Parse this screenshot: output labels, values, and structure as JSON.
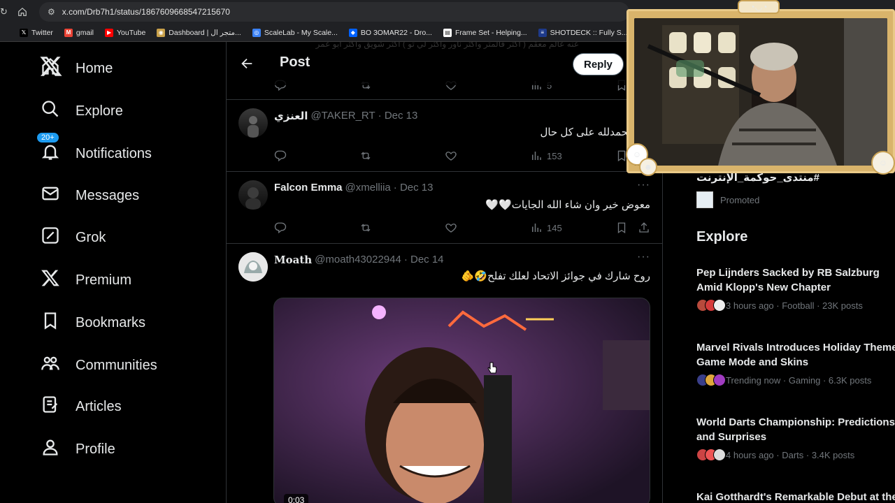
{
  "browser": {
    "url": "x.com/Drb7h1/status/1867609668547215670",
    "bookmarks": [
      {
        "label": "Twitter",
        "color": "#000000",
        "glyph": "𝕏"
      },
      {
        "label": "gmail",
        "color": "#ea4335",
        "glyph": "M"
      },
      {
        "label": "YouTube",
        "color": "#ff0000",
        "glyph": "▶"
      },
      {
        "label": "Dashboard | متجر ال...",
        "color": "#c9a14a",
        "glyph": "◉"
      },
      {
        "label": "ScaleLab - My Scale...",
        "color": "#3b82f6",
        "glyph": "◎"
      },
      {
        "label": "BO 3OMAR22 - Dro...",
        "color": "#0061fe",
        "glyph": "◆"
      },
      {
        "label": "Frame Set - Helping...",
        "color": "#ffffff",
        "glyph": "▤"
      },
      {
        "label": "SHOTDECK :: Fully S...",
        "color": "#1e3a8a",
        "glyph": "≡"
      }
    ]
  },
  "nav": {
    "items": [
      {
        "label": "Home",
        "icon": "home-icon"
      },
      {
        "label": "Explore",
        "icon": "search-icon"
      },
      {
        "label": "Notifications",
        "icon": "bell-icon",
        "badge": "20+"
      },
      {
        "label": "Messages",
        "icon": "envelope-icon"
      },
      {
        "label": "Grok",
        "icon": "grok-icon"
      },
      {
        "label": "Premium",
        "icon": "x-logo-icon"
      },
      {
        "label": "Bookmarks",
        "icon": "bookmark-icon"
      },
      {
        "label": "Communities",
        "icon": "communities-icon"
      },
      {
        "label": "Articles",
        "icon": "articles-icon"
      },
      {
        "label": "Profile",
        "icon": "profile-icon"
      }
    ]
  },
  "header": {
    "title": "Post",
    "reply_label": "Reply",
    "ghost_text": "عنه عالم معقم ( اكثر قالمتر واكثر ناور واكثر لي تو ) اكثر شويق واكثر ابو عمر"
  },
  "top_actions": {
    "views": "5"
  },
  "tweets": [
    {
      "name": "العنزي",
      "handle": "@TAKER_RT",
      "date": "· Dec 13",
      "text": "❤️ الحمدلله على كل حال",
      "views": "153"
    },
    {
      "name": "Falcon Emma",
      "handle": "@xmelliia",
      "date": "· Dec 13",
      "text": "معوض خير وان شاء الله الجايات🤍🤍",
      "views": "145"
    },
    {
      "name": "Moath",
      "handle": "@moath43022944",
      "date": "· Dec 14",
      "text": "روح شارك في جوائز الاتحاد لعلك تفلح🤣🫵",
      "video_time": "0:03"
    }
  ],
  "right": {
    "trend_hashtag": "#منتدى_حوكمة_الإنترنت",
    "promoted_label": "Promoted",
    "explore_title": "Explore",
    "stories": [
      {
        "title": "Pep Lijnders Sacked by RB Salzburg Amid Klopp's New Chapter",
        "meta": "3 hours ago · Football · 23K posts"
      },
      {
        "title": "Marvel Rivals Introduces Holiday Themed Game Mode and Skins",
        "meta": "Trending now · Gaming · 6.3K posts"
      },
      {
        "title": "World Darts Championship: Predictions and Surprises",
        "meta": "4 hours ago · Darts · 3.4K posts"
      },
      {
        "title": "Kai Gotthardt's Remarkable Debut at the",
        "meta": ""
      }
    ]
  },
  "colors": {
    "accent": "#1d9bf0",
    "heart": "#f91880",
    "bg": "#000000",
    "muted": "#71767b"
  }
}
